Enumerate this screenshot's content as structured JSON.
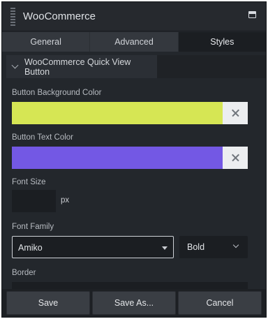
{
  "window": {
    "title": "WooCommerce"
  },
  "tabs": [
    {
      "label": "General",
      "active": false
    },
    {
      "label": "Advanced",
      "active": false
    },
    {
      "label": "Styles",
      "active": true
    }
  ],
  "section": {
    "title": "WooCommerce Quick View Button"
  },
  "fields": {
    "bg_color": {
      "label": "Button Background Color",
      "color": "#d6e654"
    },
    "text_color": {
      "label": "Button Text Color",
      "color": "#7358e4"
    },
    "font_size": {
      "label": "Font Size",
      "value": "",
      "unit": "px"
    },
    "font_family": {
      "label": "Font Family",
      "value": "Amiko",
      "weight": "Bold"
    },
    "border": {
      "label": "Border"
    }
  },
  "footer": {
    "save": "Save",
    "save_as": "Save As...",
    "cancel": "Cancel"
  }
}
